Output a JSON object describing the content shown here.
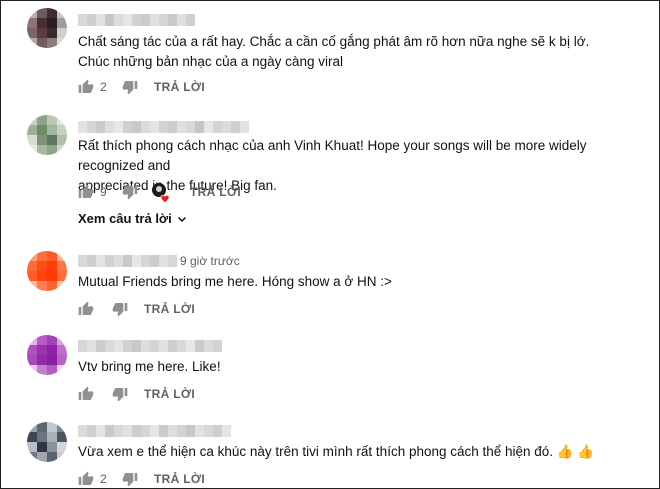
{
  "colors": {
    "text": "#111111",
    "muted": "#606060",
    "heart": "#e62117"
  },
  "comments": [
    {
      "time": "",
      "text_lines": [
        "Chất sáng tác của a rất hay. Chắc a cần cố gắng phát âm rõ hơn nữa nghe sẽ k bị lớ.",
        "Chúc những bản nhạc của a ngày càng viral"
      ],
      "likes": "2",
      "reply_label": "TRẢ LỜI",
      "avatar_colors": [
        "#b8aeb0",
        "#6e5a5e",
        "#3b2d30",
        "#c9c1c3",
        "#8c7479",
        "#4a2e33",
        "#2a1d20",
        "#a39a9c",
        "#7d6468",
        "#5b3c40",
        "#3a2a2c",
        "#d3cccd",
        "#b1a7a9",
        "#6f5c5f",
        "#8a7b7d",
        "#e0dadb"
      ],
      "name_shades": [
        "#d8d8d8",
        "#cfcfcf",
        "#e2e2e2",
        "#c7c7c7",
        "#dcdcdc",
        "#e6e6e6",
        "#d2d2d2",
        "#cbcbcb",
        "#e0e0e0",
        "#d5d5d5",
        "#c9c9c9",
        "#dedede",
        "#d0d0d0"
      ]
    },
    {
      "time": "",
      "text_lines": [
        "Rất thích phong cách nhạc của anh Vinh Khuat! Hope your songs will be more widely recognized and",
        "appreciated in the future! Big fan."
      ],
      "likes": "9",
      "reply_label": "TRẢ LỜI",
      "view_replies": "Xem câu trả lời",
      "avatar_colors": [
        "#c9d3c5",
        "#8fa38c",
        "#b9c7b4",
        "#dfe6dc",
        "#9bb094",
        "#6f8a6b",
        "#a3b7a0",
        "#c4d0c0",
        "#d6ded2",
        "#7e9479",
        "#5f765b",
        "#b0bfac",
        "#e3e9e0",
        "#a7b8a2",
        "#8ea489",
        "#cfd9cb"
      ],
      "name_shades": [
        "#e2e2e2",
        "#d6d6d6",
        "#cbcbcb",
        "#dedede",
        "#e8e8e8",
        "#d0d0d0",
        "#c8c8c8",
        "#dadada",
        "#e4e4e4",
        "#d3d3d3",
        "#cdcdcd",
        "#e0e0e0",
        "#d8d8d8",
        "#c6c6c6",
        "#e6e6e6",
        "#d4d4d4",
        "#dcdcdc",
        "#cfcfcf",
        "#e1e1e1"
      ]
    },
    {
      "time": "9 giờ trước",
      "text_lines": [
        "Mutual Friends bring me here. Hóng show a ở HN :>"
      ],
      "likes": "",
      "reply_label": "TRẢ LỜI",
      "avatar_colors": [
        "#ff9a7a",
        "#ff6e3f",
        "#ff5a26",
        "#ffab8f",
        "#ff6a38",
        "#ff4b14",
        "#ff3e06",
        "#ff7648",
        "#ff5c27",
        "#ff4210",
        "#ff3a02",
        "#ff6b3a",
        "#ffb79f",
        "#ff7d52",
        "#ff6231",
        "#ffc4b1"
      ],
      "name_shades": [
        "#d9d9d9",
        "#cfcfcf",
        "#e3e3e3",
        "#d2d2d2",
        "#dedede",
        "#c9c9c9",
        "#e6e6e6",
        "#d5d5d5",
        "#cdcdcd",
        "#e0e0e0",
        "#d7d7d7"
      ]
    },
    {
      "time": "",
      "text_lines": [
        "Vtv bring me here. Like!"
      ],
      "likes": "",
      "reply_label": "TRẢ LỜI",
      "avatar_colors": [
        "#e4b3ea",
        "#b65ac4",
        "#a043b4",
        "#d9a0e0",
        "#b24ec2",
        "#9a33ad",
        "#8f22a5",
        "#c06ccc",
        "#a749b8",
        "#922aa7",
        "#8a1ea0",
        "#b861c6",
        "#ecc7f0",
        "#c37dcf",
        "#b05dc1",
        "#f2d6f4"
      ],
      "name_shades": [
        "#d6d6d6",
        "#e0e0e0",
        "#cccccc",
        "#dadada",
        "#e4e4e4",
        "#d1d1d1",
        "#c8c8c8",
        "#dddddd",
        "#d4d4d4",
        "#e2e2e2",
        "#cfcfcf",
        "#d8d8d8",
        "#e6e6e6",
        "#cacaca",
        "#dcdcdc",
        "#d3d3d3"
      ]
    },
    {
      "time": "",
      "text_lines": [
        "Vừa xem e thể hiện ca khúc này trên tivi mình rất thích phong cách thể hiện đó. 👍 👍"
      ],
      "likes": "2",
      "reply_label": "TRẢ LỜI",
      "avatar_colors": [
        "#9aa2ad",
        "#5e6672",
        "#c2c7ce",
        "#7d858f",
        "#3e4550",
        "#6b7480",
        "#a9b0b8",
        "#4c5460",
        "#b8bec5",
        "#2f3642",
        "#8a929c",
        "#d3d7dc",
        "#717a85",
        "#9fa6af",
        "#5a636e",
        "#c9cdd3"
      ],
      "name_shades": [
        "#dcdcdc",
        "#d0d0d0",
        "#e4e4e4",
        "#c9c9c9",
        "#d8d8d8",
        "#e1e1e1",
        "#cdcdcd",
        "#d6d6d6",
        "#e6e6e6",
        "#cbcbcb",
        "#dedede",
        "#d3d3d3",
        "#c7c7c7",
        "#e2e2e2",
        "#d9d9d9",
        "#cfcfcf",
        "#e5e5e5"
      ]
    }
  ]
}
